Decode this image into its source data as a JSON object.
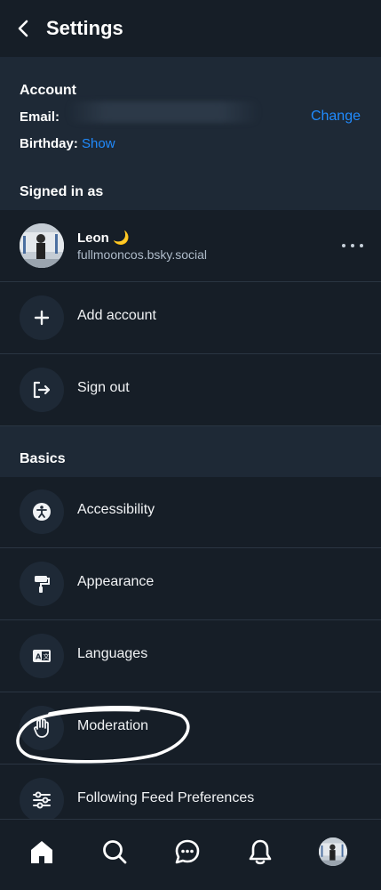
{
  "header": {
    "title": "Settings"
  },
  "account": {
    "heading": "Account",
    "email_label": "Email:",
    "change_label": "Change",
    "birthday_label": "Birthday:",
    "birthday_show": "Show"
  },
  "signed_in": {
    "heading": "Signed in as",
    "user": {
      "name": "Leon 🌙",
      "handle": "fullmooncos.bsky.social"
    },
    "items": [
      {
        "label": "Add account",
        "icon": "plus-icon"
      },
      {
        "label": "Sign out",
        "icon": "sign-out-icon"
      }
    ]
  },
  "basics": {
    "heading": "Basics",
    "items": [
      {
        "label": "Accessibility",
        "icon": "accessibility-icon"
      },
      {
        "label": "Appearance",
        "icon": "paint-roller-icon"
      },
      {
        "label": "Languages",
        "icon": "language-icon"
      },
      {
        "label": "Moderation",
        "icon": "hand-icon"
      },
      {
        "label": "Following Feed Preferences",
        "icon": "sliders-icon"
      }
    ]
  },
  "tabbar": {
    "items": [
      "home-icon",
      "search-icon",
      "chat-icon",
      "bell-icon",
      "profile-avatar"
    ]
  },
  "colors": {
    "background": "#161e27",
    "panel": "#1e2936",
    "accent": "#208bfe"
  }
}
